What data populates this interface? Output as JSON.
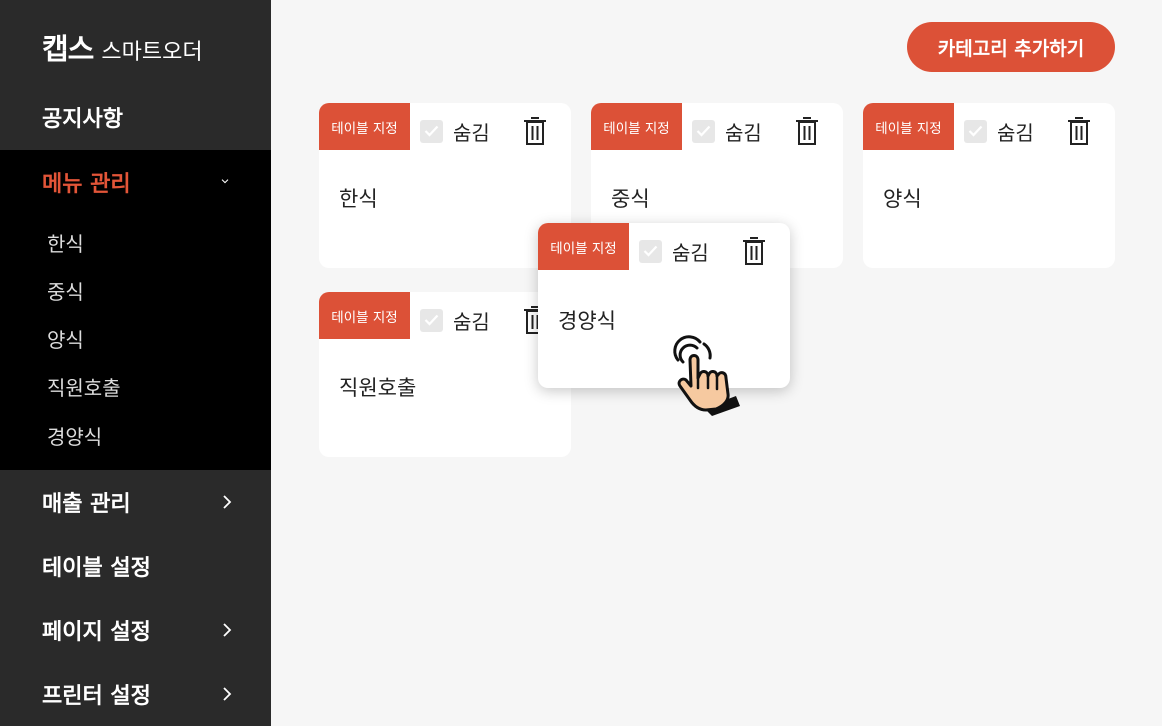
{
  "brand": {
    "logo": "캡스",
    "subtitle": "스마트오더"
  },
  "sidebar": {
    "notice": "공지사항",
    "menu_manage": "메뉴 관리",
    "menu_sub": [
      "한식",
      "중식",
      "양식",
      "직원호출",
      "경양식"
    ],
    "sales_manage": "매출 관리",
    "table_settings": "테이블 설정",
    "page_settings": "페이지 설정",
    "printer_settings": "프린터 설정"
  },
  "main": {
    "add_category_label": "카테고리 추가하기",
    "tag_label": "테이블 지정",
    "hide_label": "숨김",
    "cards": [
      "한식",
      "중식",
      "양식",
      "직원호출"
    ],
    "dragging_card": "경양식"
  },
  "colors": {
    "accent": "#dc5137",
    "sidebar_bg": "#2a2a2a",
    "submenu_bg": "#000000"
  }
}
